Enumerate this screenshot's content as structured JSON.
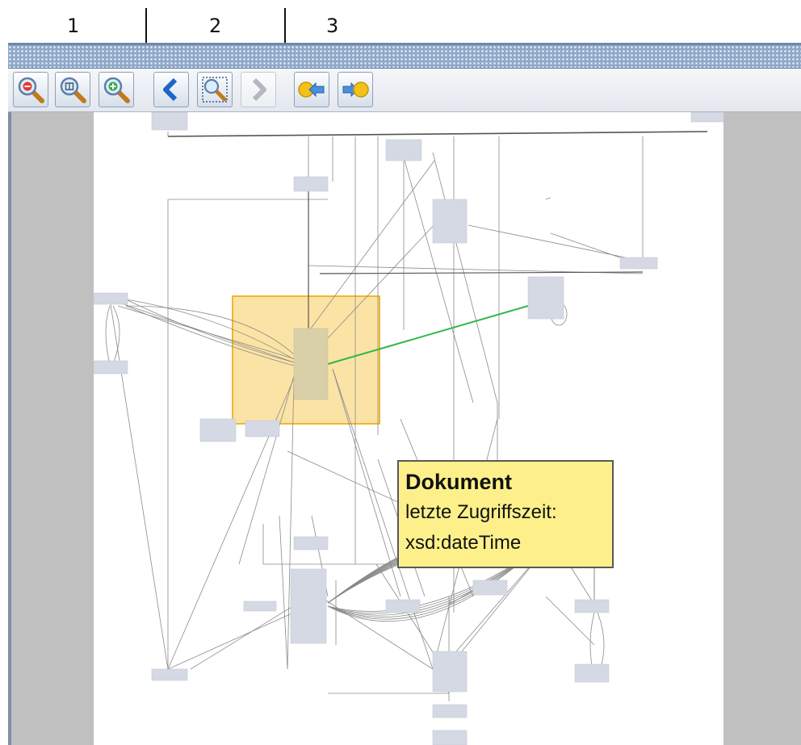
{
  "annotations": {
    "groups": [
      "1",
      "2",
      "3"
    ]
  },
  "toolbar": {
    "zoom_out_icon": "zoom-out-magnifier-icon",
    "zoom_reset_icon": "zoom-reset-magnifier-icon",
    "zoom_in_icon": "zoom-in-magnifier-icon",
    "back_icon": "chevron-left-icon",
    "focus_icon": "magnifier-selection-icon",
    "forward_icon": "chevron-right-icon",
    "collapse_icon": "node-arrow-left-icon",
    "expand_icon": "node-arrow-right-icon",
    "forward_enabled": false
  },
  "tooltip": {
    "title": "Dokument",
    "line1": "letzte Zugriffszeit:",
    "line2": "xsd:dateTime"
  },
  "colors": {
    "grip_bar": "#8ea8c8",
    "node_fill": "#d5d9e4",
    "selection_fill": "#fbe3a5",
    "selection_border": "#f0b72c",
    "highlight_edge": "#2fb84a",
    "tooltip_bg": "#fdf08a",
    "viewport_bg": "#c0c0c0"
  }
}
